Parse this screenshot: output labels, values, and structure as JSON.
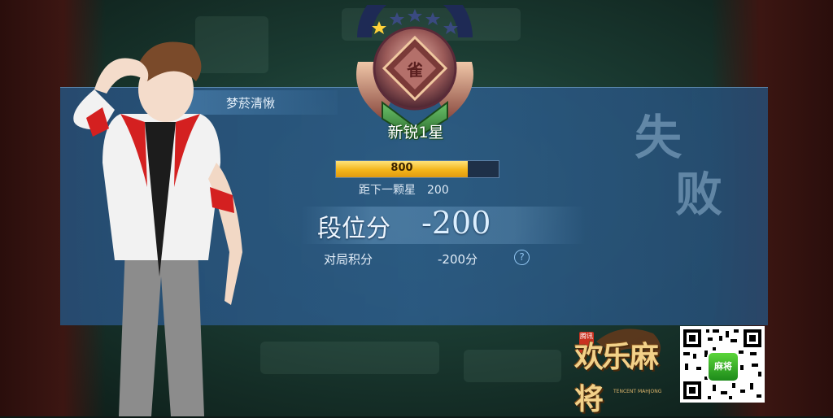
{
  "player": {
    "name": "梦菸清愀"
  },
  "rank": {
    "title": "新锐1星",
    "stars_total": 5,
    "stars_filled": 1,
    "tile_char": "雀"
  },
  "progress": {
    "value_label": "800",
    "fraction": 0.81
  },
  "next_star": {
    "label": "距下一颗星",
    "value": "200"
  },
  "result": {
    "text": "失败",
    "char1": "失",
    "char2": "败"
  },
  "score": {
    "label": "段位分",
    "value": "-200"
  },
  "match_score": {
    "label": "对局积分",
    "value": "-200分",
    "help_icon": "?"
  },
  "logo": {
    "text": "欢乐麻将",
    "tag": "腾讯",
    "sub": "TENCENT MAHJONG"
  },
  "qr_code": {
    "app_icon": "麻将"
  },
  "colors": {
    "panel": "#2c5c8a",
    "progress_fill": "#f4b51a",
    "rank_text_shadow": "#1d4d1d"
  }
}
